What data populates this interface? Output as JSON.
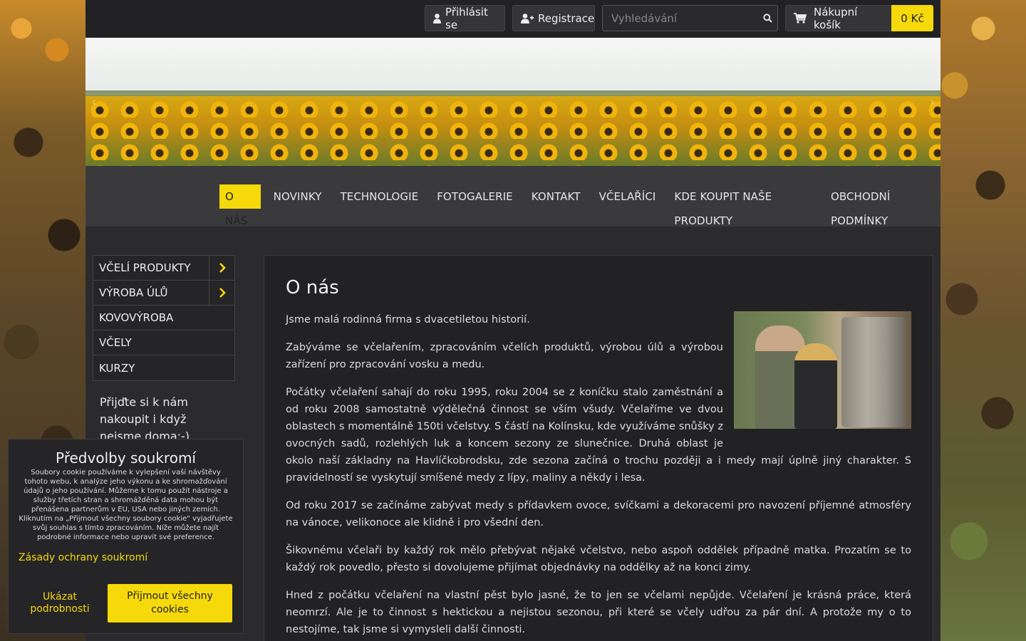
{
  "topbar": {
    "login_label": "Přihlásit se",
    "register_label": "Registrace",
    "search_placeholder": "Vyhledávání",
    "cart_label": "Nákupní košík",
    "cart_total": "0 Kč"
  },
  "nav": {
    "items": [
      {
        "label": "O NÁS",
        "active": true
      },
      {
        "label": "NOVINKY"
      },
      {
        "label": "TECHNOLOGIE"
      },
      {
        "label": "FOTOGALERIE"
      },
      {
        "label": "KONTAKT"
      },
      {
        "label": "VČELAŘÍCI"
      },
      {
        "label": "KDE KOUPIT NAŠE PRODUKTY"
      },
      {
        "label": "OBCHODNÍ PODMÍNKY"
      }
    ]
  },
  "sidebar": {
    "items": [
      {
        "label": "VČELÍ PRODUKTY"
      },
      {
        "label": "VÝROBA ÚLŮ"
      },
      {
        "label": "KOVOVÝROBA"
      },
      {
        "label": "VČELY"
      },
      {
        "label": "KURZY"
      }
    ],
    "note": "Přijďte si k nám nakoupit i když nejsme doma:-)"
  },
  "content": {
    "title": "O nás",
    "paragraphs": [
      "Jsme malá rodinná firma s dvacetiletou historií.",
      "Zabýváme se včelařením, zpracováním včelích produktů, výrobou úlů a výrobou zařízení pro zpracování vosku a medu.",
      "Počátky včelaření sahají do roku 1995, roku 2004 se z koníčku stalo zaměstnání a od roku 2008 samostatně výdělečná činnost se vším všudy. Včelaříme ve dvou oblastech s momentálně 150ti včelstvy. S částí na Kolínsku, kde využíváme snůšky z ovocných sadů, rozlehlých luk a koncem sezony ze slunečnice. Druhá oblast je okolo naší základny na Havlíčkobrodsku, zde sezona začíná o trochu později a i medy mají úplně jiný charakter. S pravidelností se vyskytují smíšené medy z lípy, maliny a někdy i lesa.",
      "Od roku 2017 se začínáme zabývat medy s přídavkem ovoce, svíčkami a dekoracemi pro navození příjemné atmosféry na vánoce, velikonoce ale klidně i pro všední den.",
      "Šikovnému včelaři by každý rok mělo přebývat nějaké včelstvo, nebo aspoň oddělek případně matka. Prozatím se to každý rok povedlo, přesto si dovolujeme přijímat objednávky na oddělky až na konci zimy.",
      "Hned z počátku včelaření na vlastní pěst bylo jasné, že to jen se včelami nepůjde. Včelaření je krásná práce, která neomrzí. Ale je to činnost s hektickou a nejistou sezonou, při které se včely udřou za pár dní. A protože my o to nestojíme, tak jsme si vymysleli další činnosti."
    ]
  },
  "cookie": {
    "title": "Předvolby soukromí",
    "text": "Soubory cookie používáme k vylepšení vaší návštěvy tohoto webu, k analýze jeho výkonu a ke shromažďování údajů o jeho používání. Můžeme k tomu použít nástroje a služby třetích stran a shromážděná data mohou být přenášena partnerům v EU, USA nebo jiných zemích. Kliknutím na „Přijmout všechny soubory cookie\" vyjadřujete svůj souhlas s tímto zpracováním. Níže můžete najít podrobné informace nebo upravit své preference.",
    "privacy_link": "Zásady ochrany soukromí",
    "details_label": "Ukázat podrobnosti",
    "accept_label": "Přijmout všechny cookies"
  },
  "colors": {
    "accent": "#f5d90a",
    "page_bg": "#2b2b2d"
  }
}
